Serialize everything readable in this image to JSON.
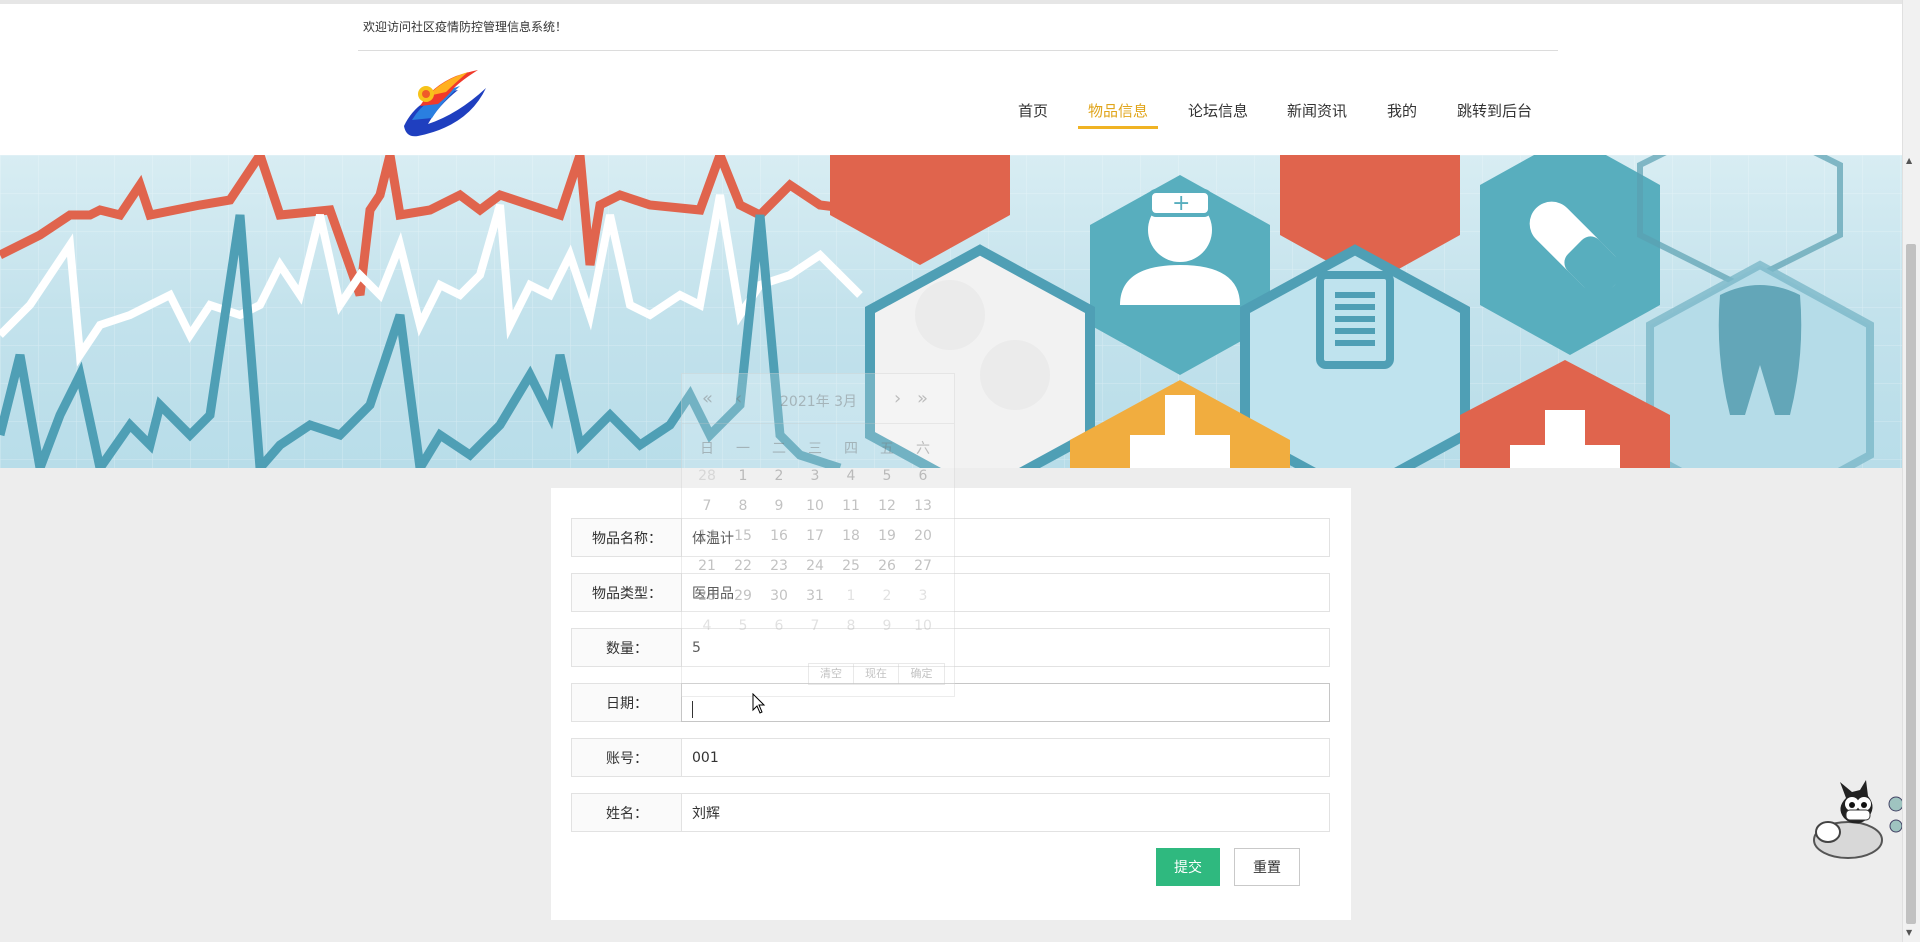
{
  "header": {
    "welcome_text": "欢迎访问社区疫情防控管理信息系统！",
    "nav": [
      {
        "label": "首页",
        "active": false
      },
      {
        "label": "物品信息",
        "active": true
      },
      {
        "label": "论坛信息",
        "active": false
      },
      {
        "label": "新闻资讯",
        "active": false
      },
      {
        "label": "我的",
        "active": false
      },
      {
        "label": "跳转到后台",
        "active": false
      }
    ]
  },
  "form": {
    "fields": [
      {
        "label": "物品名称：",
        "value": "体温计"
      },
      {
        "label": "物品类型：",
        "value": "医用品"
      },
      {
        "label": "数量：",
        "value": "5"
      },
      {
        "label": "日期：",
        "value": ""
      },
      {
        "label": "账号：",
        "value": "001"
      },
      {
        "label": "姓名：",
        "value": "刘辉"
      }
    ],
    "submit_label": "提交",
    "reset_label": "重置"
  },
  "datepicker": {
    "year_month": "2021年  3月",
    "prev_year_icon": "«",
    "prev_month_icon": "‹",
    "next_month_icon": "›",
    "next_year_icon": "»",
    "weekdays": [
      "日",
      "一",
      "二",
      "三",
      "四",
      "五",
      "六"
    ],
    "weeks": [
      [
        "28",
        "1",
        "2",
        "3",
        "4",
        "5",
        "6"
      ],
      [
        "7",
        "8",
        "9",
        "10",
        "11",
        "12",
        "13"
      ],
      [
        "14",
        "15",
        "16",
        "17",
        "18",
        "19",
        "20"
      ],
      [
        "21",
        "22",
        "23",
        "24",
        "25",
        "26",
        "27"
      ],
      [
        "28",
        "29",
        "30",
        "31",
        "1",
        "2",
        "3"
      ],
      [
        "4",
        "5",
        "6",
        "7",
        "8",
        "9",
        "10"
      ]
    ],
    "clear_label": "清空",
    "now_label": "现在",
    "confirm_label": "确定"
  },
  "colors": {
    "accent": "#f0b323",
    "active_nav": "#e0a51c",
    "submit": "#2fb97f",
    "banner_red": "#e0644d",
    "banner_teal": "#4f9fb5",
    "banner_orange": "#f1ad3f"
  }
}
